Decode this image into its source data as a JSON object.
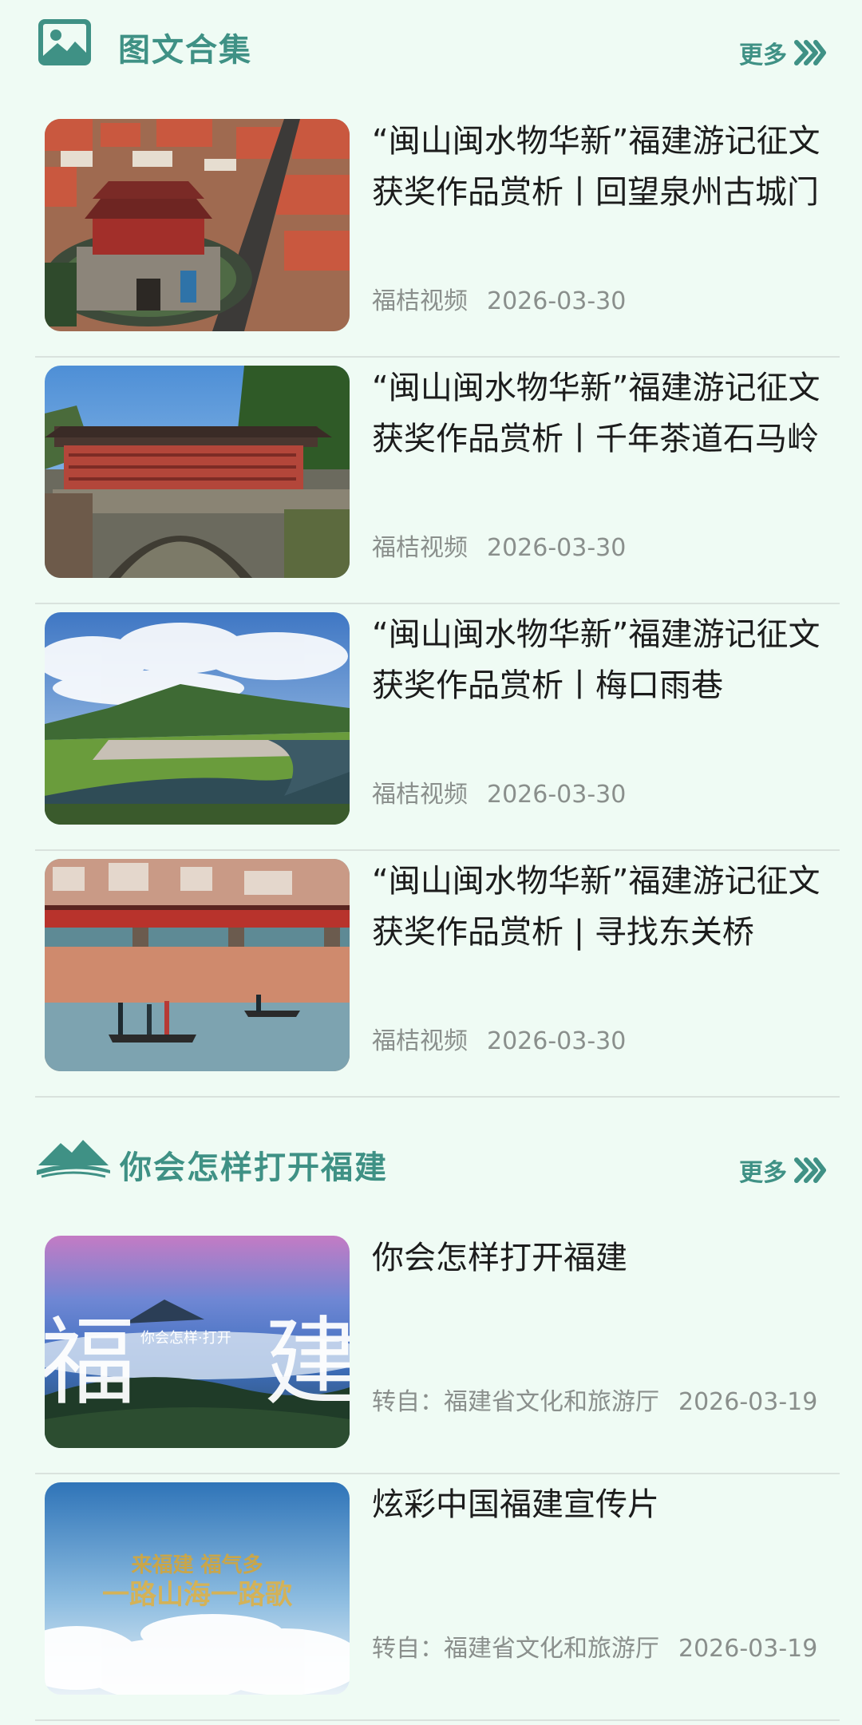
{
  "section1": {
    "title": "图文合集",
    "more_label": "更多",
    "items": [
      {
        "title": "“闽山闽水物华新”福建游记征文获奖作品赏析丨回望泉州古城门",
        "source": "福桔视频",
        "date": "2026-03-30"
      },
      {
        "title": "“闽山闽水物华新”福建游记征文获奖作品赏析丨千年茶道石马岭",
        "source": "福桔视频",
        "date": "2026-03-30"
      },
      {
        "title": "“闽山闽水物华新”福建游记征文获奖作品赏析丨梅口雨巷",
        "source": "福桔视频",
        "date": "2026-03-30"
      },
      {
        "title": "“闽山闽水物华新”福建游记征文获奖作品赏析 | 寻找东关桥",
        "source": "福桔视频",
        "date": "2026-03-30"
      }
    ]
  },
  "section2": {
    "title": "你会怎样打开福建",
    "more_label": "更多",
    "items": [
      {
        "title": "你会怎样打开福建",
        "source": "转自：福建省文化和旅游厅",
        "date": "2026-03-19",
        "thumb_caption": "你会怎样·打开",
        "thumb_glyph_left": "福",
        "thumb_glyph_right": "建"
      },
      {
        "title": "炫彩中国福建宣传片",
        "source": "转自：福建省文化和旅游厅",
        "date": "2026-03-19",
        "thumb_caption_top": "来福建 福气多",
        "thumb_caption_bottom": "一路山海一路歌"
      }
    ]
  },
  "colors": {
    "background": "#effbf4",
    "accent": "#3f9185",
    "meta_text": "#8a8f8c",
    "divider": "#d9e2dd"
  },
  "icons": {
    "section1": "image-gallery-icon",
    "section2": "mountain-icon",
    "more": "double-chevron-right-icon"
  }
}
